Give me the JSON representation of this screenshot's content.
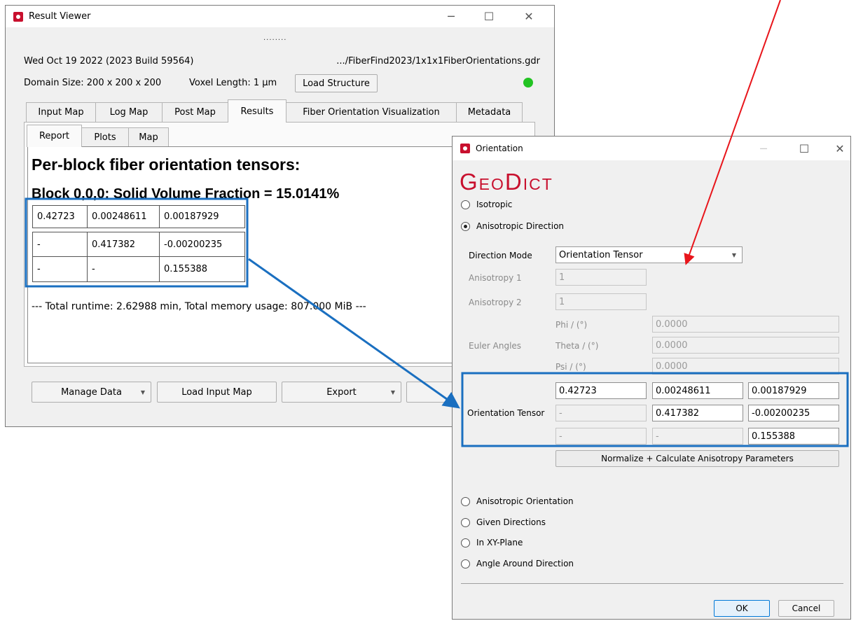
{
  "result_viewer": {
    "title": "Result Viewer",
    "grip": "........",
    "date_build": "Wed Oct 19 2022 (2023 Build 59564)",
    "file_path": ".../FiberFind2023/1x1x1FiberOrientations.gdr",
    "domain_size": "Domain Size: 200 x 200 x 200",
    "voxel_length": "Voxel Length: 1 µm",
    "load_structure": "Load Structure",
    "status_color": "#22c322",
    "tabs": [
      "Input Map",
      "Log Map",
      "Post Map",
      "Results",
      "Fiber Orientation Visualization",
      "Metadata"
    ],
    "subtabs": [
      "Report",
      "Plots",
      "Map"
    ],
    "report": {
      "heading": "Per-block fiber orientation tensors:",
      "block_line": "Block 0,0,0: Solid Volume Fraction = 15.0141%",
      "tensor": [
        [
          "0.42723",
          "0.00248611",
          "0.00187929"
        ],
        [
          "-",
          "0.417382",
          "-0.00200235"
        ],
        [
          "-",
          "-",
          "0.155388"
        ]
      ],
      "footer": "--- Total runtime: 2.62988 min, Total memory usage: 807.000 MiB ---"
    },
    "buttons": {
      "manage_data": "Manage Data",
      "load_input_map": "Load Input Map",
      "export": "Export"
    }
  },
  "orientation": {
    "title": "Orientation",
    "logo": "GeoDict",
    "options": {
      "isotropic": "Isotropic",
      "anisotropic_direction": "Anisotropic Direction",
      "anisotropic_orientation": "Anisotropic Orientation",
      "given_directions": "Given Directions",
      "in_xy_plane": "In XY-Plane",
      "angle_around_direction": "Angle Around Direction"
    },
    "direction_mode_label": "Direction Mode",
    "direction_mode_value": "Orientation Tensor",
    "anisotropy1_label": "Anisotropy 1",
    "anisotropy1_value": "1",
    "anisotropy2_label": "Anisotropy 2",
    "anisotropy2_value": "1",
    "euler_label": "Euler Angles",
    "phi_label": "Phi / (°)",
    "phi_value": "0.0000",
    "theta_label": "Theta / (°)",
    "theta_value": "0.0000",
    "psi_label": "Psi / (°)",
    "psi_value": "0.0000",
    "tensor_label": "Orientation Tensor",
    "tensor": [
      [
        "0.42723",
        "0.00248611",
        "0.00187929"
      ],
      [
        "-",
        "0.417382",
        "-0.00200235"
      ],
      [
        "-",
        "-",
        "0.155388"
      ]
    ],
    "normalize_button": "Normalize + Calculate Anisotropy Parameters",
    "ok": "OK",
    "cancel": "Cancel"
  },
  "annotation_colors": {
    "highlight": "#1a6fc0",
    "arrow": "#e8151b"
  }
}
